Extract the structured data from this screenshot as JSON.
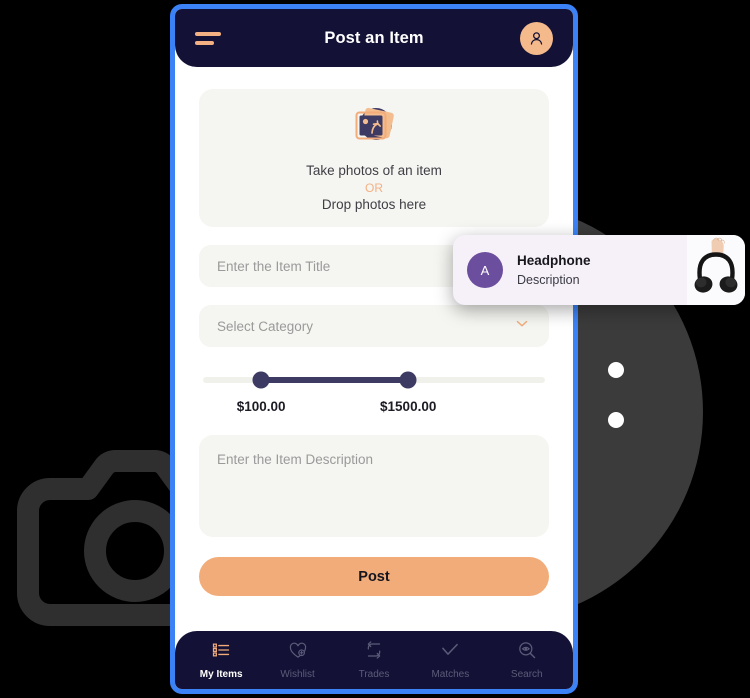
{
  "appbar": {
    "title": "Post an Item",
    "menu_icon": "hamburger-icon",
    "avatar_icon": "user-avatar-icon"
  },
  "dropzone": {
    "icon": "photo-stack-icon",
    "primary_text": "Take photos of an item",
    "or_text": "OR",
    "secondary_text": "Drop photos here"
  },
  "form": {
    "title_placeholder": "Enter the Item Title",
    "title_value": "",
    "category_placeholder": "Select Category",
    "category_value": "",
    "category_chevron": "chevron-down-icon",
    "description_placeholder": "Enter the Item Description",
    "description_value": ""
  },
  "price_slider": {
    "min_label": "$100.00",
    "max_label": "$1500.00",
    "min_value": 100,
    "max_value": 1500,
    "range_start_pct": 17,
    "range_end_pct": 60
  },
  "actions": {
    "post_label": "Post"
  },
  "bottom_nav": {
    "items": [
      {
        "label": "My Items",
        "icon": "list-icon",
        "active": true
      },
      {
        "label": "Wishlist",
        "icon": "heart-plus-icon",
        "active": false
      },
      {
        "label": "Trades",
        "icon": "swap-arrows-icon",
        "active": false
      },
      {
        "label": "Matches",
        "icon": "check-icon",
        "active": false
      },
      {
        "label": "Search",
        "icon": "search-eye-icon",
        "active": false
      }
    ]
  },
  "toast": {
    "avatar_initial": "A",
    "title": "Headphone",
    "description": "Description",
    "thumb_icon": "headphones-photo"
  },
  "background": {
    "camera_icon": "camera-outline-icon",
    "circle_color": "#3b3b3b",
    "dots": 2
  },
  "colors": {
    "phone_border": "#3b82f6",
    "navy": "#131236",
    "accent_orange": "#f2ac79",
    "light_orange": "#f3b183",
    "field_bg": "#f5f5f1",
    "slider_navy": "#3d3a63",
    "toast_bg": "#f6f0f9",
    "toast_avatar": "#6b4f9e"
  }
}
